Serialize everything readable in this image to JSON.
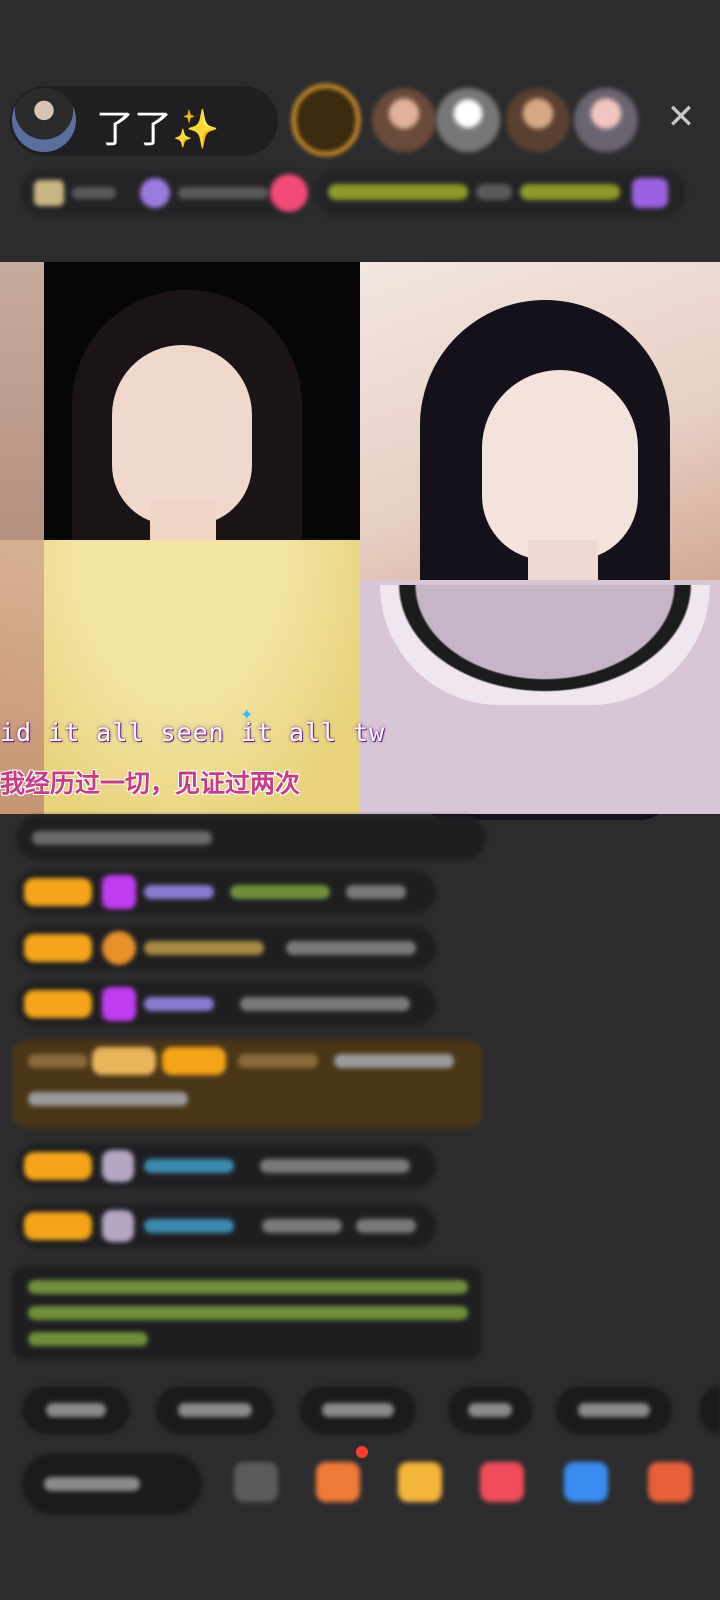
{
  "header": {
    "host_name": "了了✨"
  },
  "video": {
    "lyric_en": "id it all seen it all tw",
    "lyric_cn": "我经历过一切，见证过两次"
  },
  "colors": {
    "background": "#2c2c2e",
    "badge": "#f5a418",
    "gem": "#c23cf0",
    "lyric_cn": "#c93b86"
  }
}
